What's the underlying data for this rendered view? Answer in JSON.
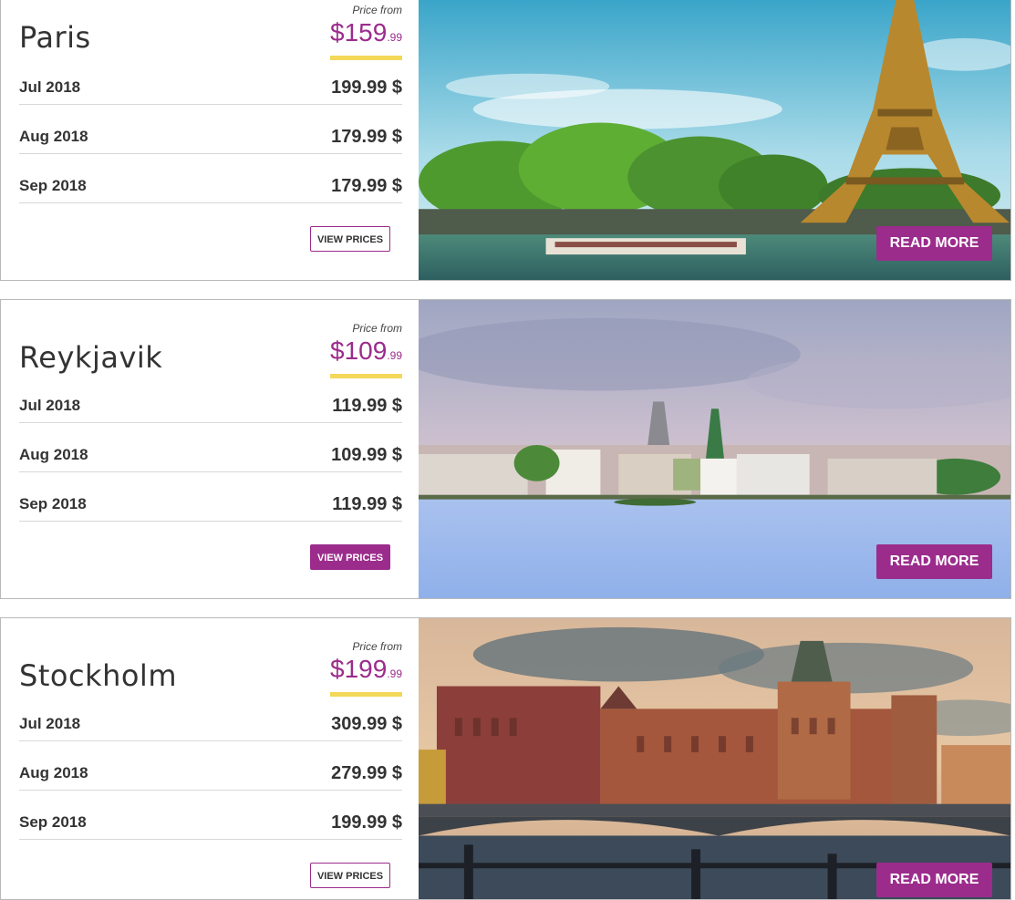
{
  "cards": [
    {
      "city": "Paris",
      "price_from_label": "Price from",
      "price_dollars": "$159",
      "price_cents": ".99",
      "rows": [
        {
          "month": "Jul 2018",
          "price": "199.99 $"
        },
        {
          "month": "Aug 2018",
          "price": "179.99 $"
        },
        {
          "month": "Sep 2018",
          "price": "179.99 $"
        }
      ],
      "view_prices_label": "VIEW PRICES",
      "read_more_label": "READ MORE",
      "image_icon": "eiffel-tower-photo"
    },
    {
      "city": "Reykjavik",
      "price_from_label": "Price from",
      "price_dollars": "$109",
      "price_cents": ".99",
      "rows": [
        {
          "month": "Jul 2018",
          "price": "119.99 $"
        },
        {
          "month": "Aug 2018",
          "price": "109.99 $"
        },
        {
          "month": "Sep 2018",
          "price": "119.99 $"
        }
      ],
      "view_prices_label": "VIEW PRICES",
      "read_more_label": "READ MORE",
      "image_icon": "reykjavik-lake-photo"
    },
    {
      "city": "Stockholm",
      "price_from_label": "Price from",
      "price_dollars": "$199",
      "price_cents": ".99",
      "rows": [
        {
          "month": "Jul 2018",
          "price": "309.99 $"
        },
        {
          "month": "Aug 2018",
          "price": "279.99 $"
        },
        {
          "month": "Sep 2018",
          "price": "199.99 $"
        }
      ],
      "view_prices_label": "VIEW PRICES",
      "read_more_label": "READ MORE",
      "image_icon": "stockholm-waterfront-photo"
    }
  ],
  "colors": {
    "accent": "#9b2c8c",
    "underline": "#f3d85a",
    "text": "#333333"
  }
}
